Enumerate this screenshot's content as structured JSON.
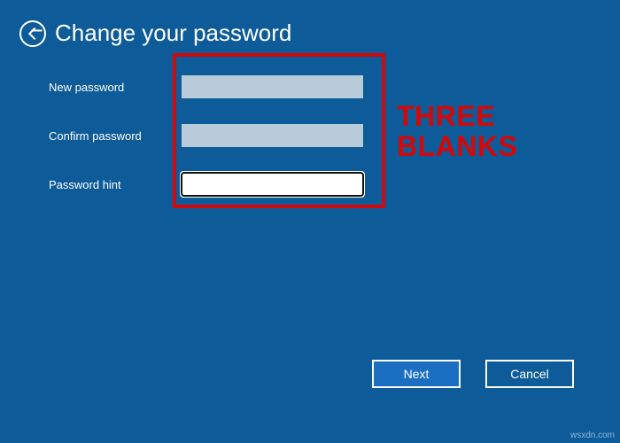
{
  "header": {
    "title": "Change your password"
  },
  "fields": {
    "new_password": {
      "label": "New password",
      "value": ""
    },
    "confirm_password": {
      "label": "Confirm password",
      "value": ""
    },
    "password_hint": {
      "label": "Password hint",
      "value": ""
    }
  },
  "annotation": {
    "line1": "THREE",
    "line2": "BLANKS"
  },
  "buttons": {
    "next": "Next",
    "cancel": "Cancel"
  },
  "watermark": "wsxdn.com"
}
